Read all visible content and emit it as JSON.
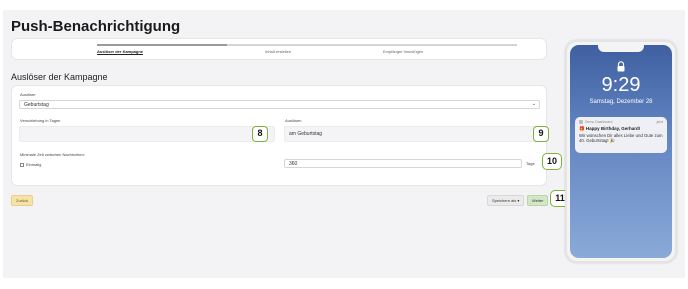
{
  "page": {
    "title": "Push-Benachrichtigung"
  },
  "stepper": {
    "steps": [
      {
        "label": "Auslöser der Kampagne",
        "active": true
      },
      {
        "label": "Inhalt erstellen",
        "active": false
      },
      {
        "label": "Empfänger hinzufügen",
        "active": false
      }
    ]
  },
  "section": {
    "title": "Auslöser der Kampagne"
  },
  "form": {
    "trigger": {
      "label": "Auslöser",
      "value": "Geburtstag"
    },
    "delay": {
      "label": "Verschiebung in Tagen",
      "value": "",
      "badge": "8"
    },
    "trigger2": {
      "label": "Auslösen",
      "value": "am Geburtstag",
      "badge": "9"
    },
    "min_time": {
      "label": "Minimale Zeit zwischen Nachrichten:",
      "once_label": "Einmalig",
      "value": "360",
      "unit": "Tage",
      "badge": "10"
    }
  },
  "footer": {
    "back_label": "Zurück",
    "save_label": "Speichern als ▾",
    "next_label": "Weiter",
    "badge": "11"
  },
  "phone": {
    "time": "9:29",
    "date": "Samstag, Dezember 28",
    "notification": {
      "app": "Demo Dashboard",
      "time": "jetzt",
      "title": "🎁 Happy Birthday, Gerhard!",
      "body": "Wir wünschen Dir alles Liebe und Gute zum 40. Geburtstag! 🎉"
    }
  },
  "colors": {
    "badge_border": "#7db33b",
    "back_button": "#f6e3a8",
    "next_button": "#d3e7c6",
    "phone_screen": "#3f5fa0"
  }
}
